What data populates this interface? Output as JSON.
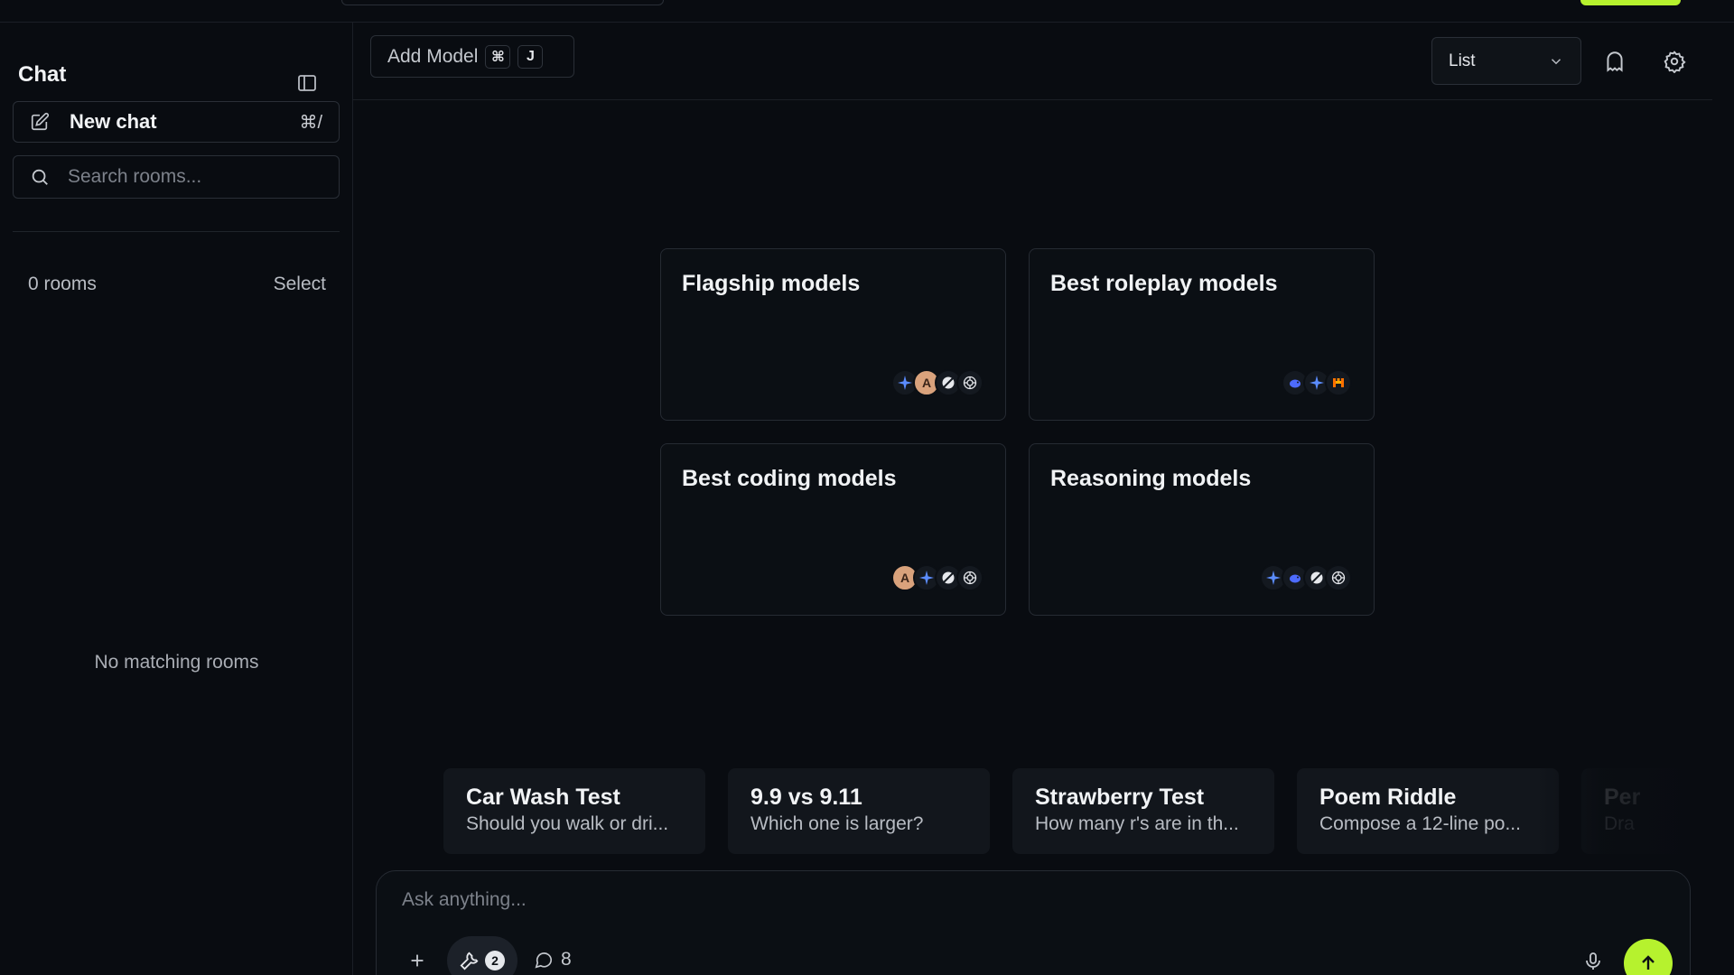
{
  "theme": {
    "accent": "#b6f22e",
    "send_button": "#5a8a12",
    "background": "#090c11"
  },
  "sidebar": {
    "title": "Chat",
    "toggle_icon": "sidebar-toggle-icon",
    "new_chat": {
      "label": "New chat",
      "shortcut": "⌘/",
      "icon": "edit-icon"
    },
    "search": {
      "placeholder": "Search rooms...",
      "value": "",
      "icon": "search-icon"
    },
    "rooms_count": "0 rooms",
    "select_label": "Select",
    "empty_message": "No matching rooms"
  },
  "header": {
    "add_model": {
      "label": "Add Model",
      "keys": [
        "⌘",
        "J"
      ]
    },
    "view_select": {
      "value": "List",
      "icon": "chevron-down-icon"
    },
    "icons": [
      "ghost-icon",
      "gear-icon"
    ]
  },
  "model_groups": [
    {
      "title": "Flagship models",
      "icons": [
        "gemini-icon",
        "claude-icon",
        "grok-icon",
        "openai-icon"
      ]
    },
    {
      "title": "Best roleplay models",
      "icons": [
        "deepseek-icon",
        "gemini-icon",
        "mistral-icon"
      ]
    },
    {
      "title": "Best coding models",
      "icons": [
        "claude-icon",
        "gemini-icon",
        "grok-icon",
        "openai-icon"
      ]
    },
    {
      "title": "Reasoning models",
      "icons": [
        "gemini-icon",
        "deepseek-icon",
        "grok-icon",
        "openai-icon"
      ]
    }
  ],
  "prompts": [
    {
      "title": "Car Wash Test",
      "subtitle": "Should you walk or dri..."
    },
    {
      "title": "9.9 vs 9.11",
      "subtitle": "Which one is larger?"
    },
    {
      "title": "Strawberry Test",
      "subtitle": "How many r's are in th..."
    },
    {
      "title": "Poem Riddle",
      "subtitle": "Compose a 12-line po..."
    },
    {
      "title": "Per",
      "subtitle": "Dra"
    }
  ],
  "composer": {
    "placeholder": "Ask anything...",
    "value": "",
    "tools_count": "2",
    "context_count": "8"
  }
}
